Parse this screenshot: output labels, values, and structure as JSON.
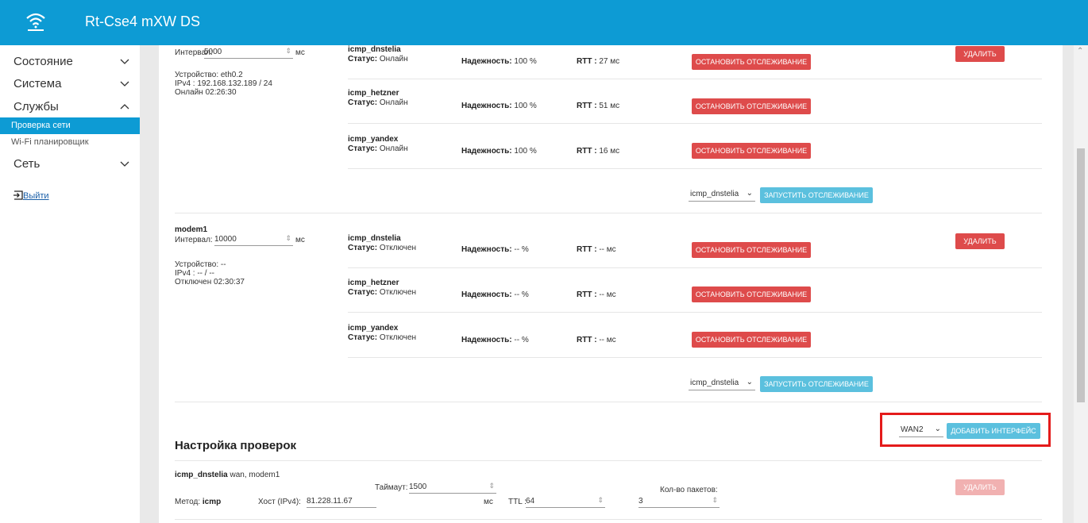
{
  "app": {
    "title": "Rt-Cse4 mXW DS"
  },
  "sidebar": {
    "items": [
      {
        "label": "Состояние"
      },
      {
        "label": "Система"
      },
      {
        "label": "Службы"
      },
      {
        "label": "Сеть"
      }
    ],
    "sub_items": [
      {
        "label": "Проверка сети"
      },
      {
        "label": "Wi-Fi планировщик"
      }
    ],
    "logout": "Выйти"
  },
  "labels": {
    "interval": "Интервал:",
    "ms": "мс",
    "status": "Статус:",
    "reliability": "Надежность:",
    "rtt": "RTT :",
    "stop": "ОСТАНОВИТЬ ОТСЛЕЖИВАНИЕ",
    "start": "ЗАПУСТИТЬ ОТСЛЕЖИВАНИЕ",
    "delete": "УДАЛИТЬ"
  },
  "interfaces": [
    {
      "name": "",
      "interval": "5000",
      "device": "Устройство: eth0.2",
      "ipv4": "IPv4 : 192.168.132.189 / 24",
      "state": "Онлайн 02:26:30",
      "checks": [
        {
          "name": "icmp_dnstelia",
          "status": "Онлайн",
          "reliability": "100 %",
          "rtt": "27 мс"
        },
        {
          "name": "icmp_hetzner",
          "status": "Онлайн",
          "reliability": "100 %",
          "rtt": "51 мс"
        },
        {
          "name": "icmp_yandex",
          "status": "Онлайн",
          "reliability": "100 %",
          "rtt": "16 мс"
        }
      ],
      "select": "icmp_dnstelia"
    },
    {
      "name": "modem1",
      "interval": "10000",
      "device": "Устройство: --",
      "ipv4": "IPv4 : -- / --",
      "state": "Отключен 02:30:37",
      "checks": [
        {
          "name": "icmp_dnstelia",
          "status": "Отключен",
          "reliability": "-- %",
          "rtt": "-- мс"
        },
        {
          "name": "icmp_hetzner",
          "status": "Отключен",
          "reliability": "-- %",
          "rtt": "-- мс"
        },
        {
          "name": "icmp_yandex",
          "status": "Отключен",
          "reliability": "-- %",
          "rtt": "-- мс"
        }
      ],
      "select": "icmp_dnstelia"
    }
  ],
  "add_interface": {
    "select": "WAN2",
    "button": "ДОБАВИТЬ ИНТЕРФЕЙС"
  },
  "checks_settings": {
    "heading": "Настройка проверок",
    "item": {
      "name": "icmp_dnstelia",
      "ifaces": "wan, modem1",
      "method_label": "Метод:",
      "method": "icmp",
      "host_label": "Хост (IPv4):",
      "host": "81.228.11.67",
      "timeout_label": "Таймаут:",
      "timeout": "1500",
      "timeout_unit": "мс",
      "ttl_label": "TTL :",
      "ttl": "64",
      "packets_label": "Кол-во пакетов:",
      "packets": "3",
      "delete": "УДАЛИТЬ"
    }
  }
}
